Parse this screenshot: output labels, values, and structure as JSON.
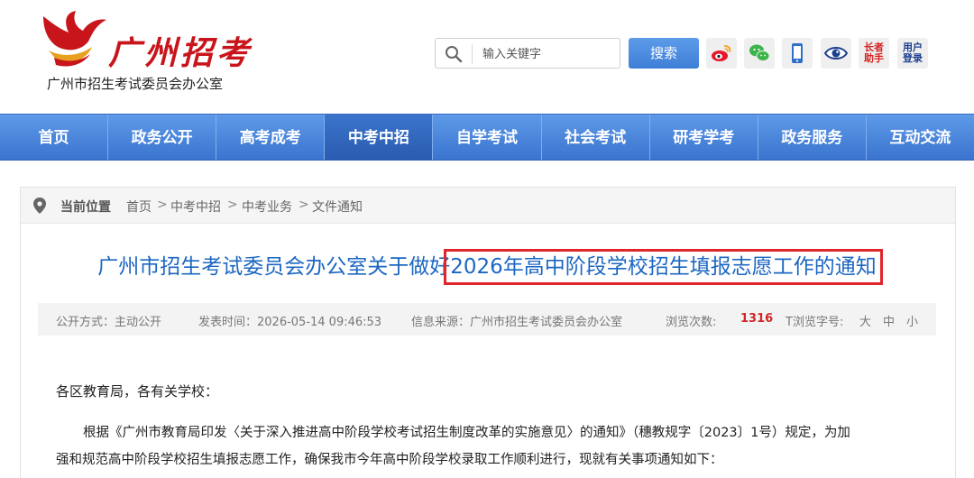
{
  "header": {
    "logo_name": "广州招考",
    "logo_sub": "广州市招生考试委员会办公室",
    "search": {
      "placeholder": "输入关键字",
      "button": "搜索"
    },
    "tools": {
      "weibo": "weibo-icon",
      "wechat": "wechat-icon",
      "mobile": "mobile-icon",
      "eye": "eye-icon",
      "elder_line1": "长者",
      "elder_line2": "助手",
      "login_line1": "用户",
      "login_line2": "登录"
    }
  },
  "nav": {
    "items": [
      "首页",
      "政务公开",
      "高考成考",
      "中考中招",
      "自学考试",
      "社会考试",
      "研考学考",
      "政务服务",
      "互动交流"
    ],
    "active_index": 3
  },
  "breadcrumb": {
    "label": "当前位置",
    "items": [
      "首页",
      "中考中招",
      "中考业务",
      "文件通知"
    ],
    "separator": ">"
  },
  "article": {
    "title_prefix": "广州市招生考试委员会办公室关于做好",
    "title_highlight": "2026年高中阶段学校招生填报志愿工作的通知",
    "meta": {
      "public_mode": "公开方式：主动公开",
      "publish_time": "发表时间：2026-05-14 09:46:53",
      "source": "信息来源：广州市招生考试委员会办公室",
      "views_label": "浏览次数:",
      "views_value": "1316",
      "font_size_label": "T浏览字号:",
      "size_large": "大",
      "size_medium": "中",
      "size_small": "小"
    },
    "salutation": "各区教育局，各有关学校：",
    "paragraph_line1": "根据《广州市教育局印发〈关于深入推进高中阶段学校考试招生制度改革的实施意见〉的通知》（穗教规字〔2023〕1号）规定，为加",
    "paragraph_line2": "强和规范高中阶段学校招生填报志愿工作，确保我市今年高中阶段学校录取工作顺利进行，现就有关事项通知如下："
  },
  "colors": {
    "brand_red": "#c8151b",
    "nav_blue": "#4a86dc",
    "title_blue": "#1c67c2",
    "highlight_box": "#e0262a",
    "views_red": "#d2262a"
  }
}
